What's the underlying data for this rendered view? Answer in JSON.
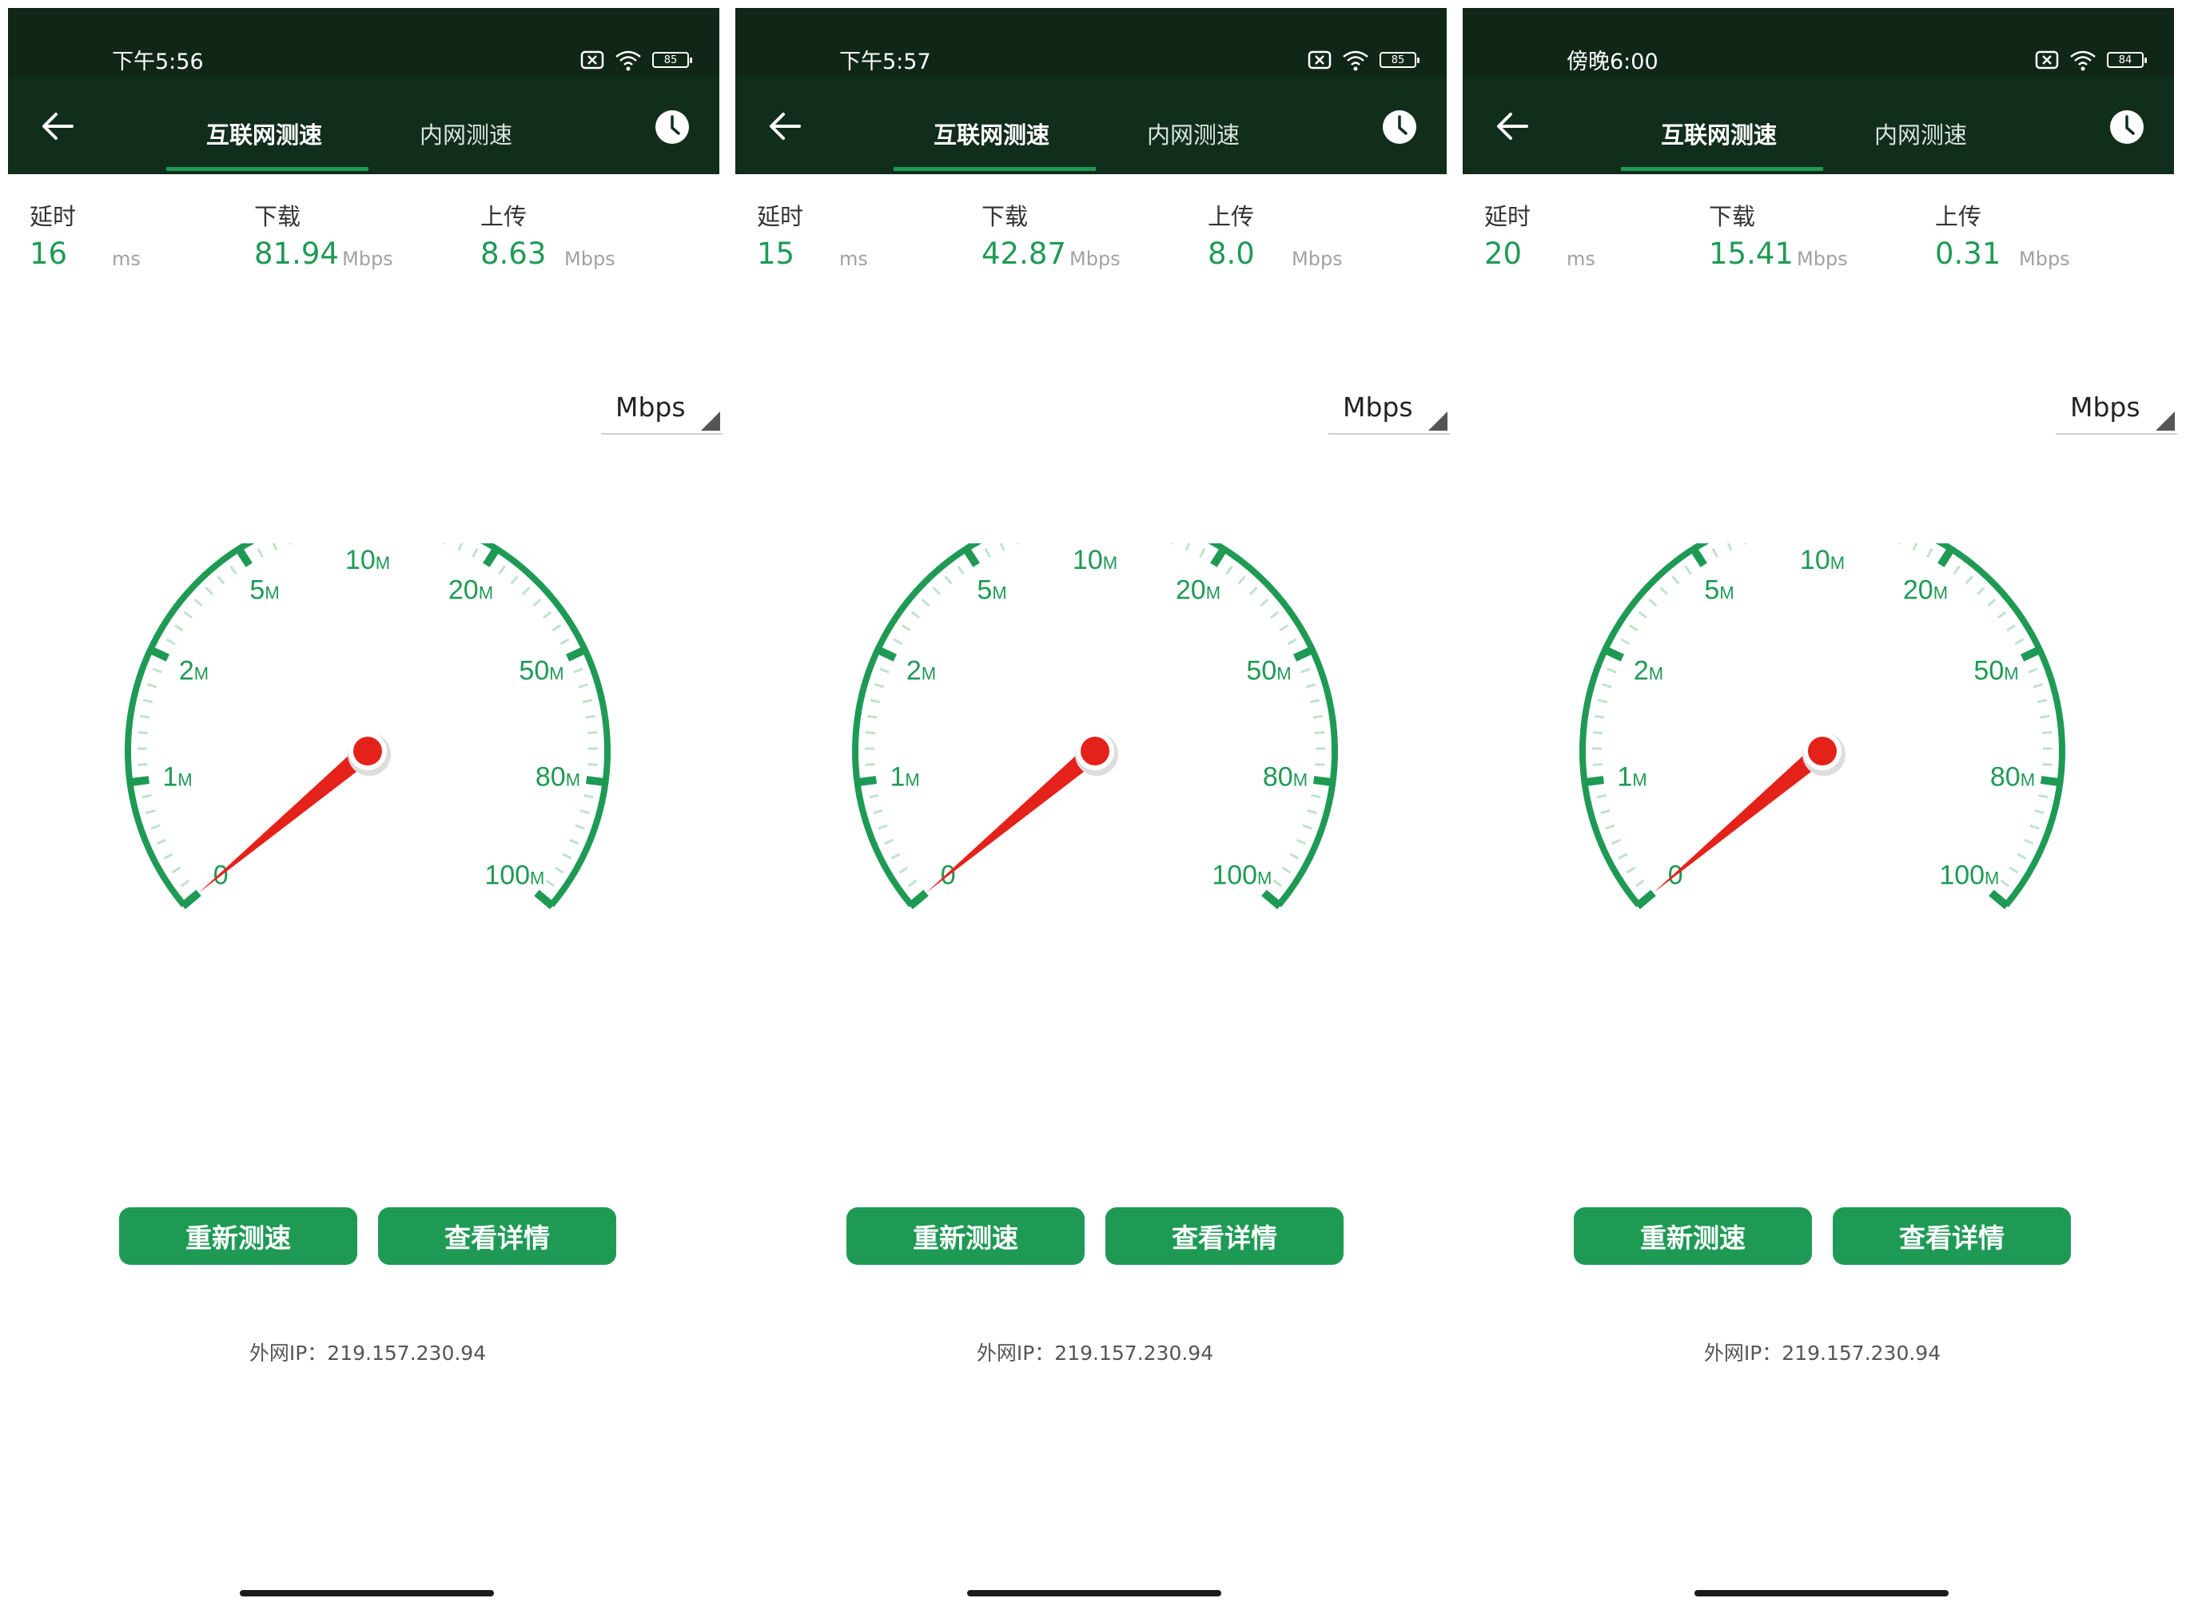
{
  "screens": [
    {
      "status": {
        "time": "下午5:56",
        "battery": "85"
      },
      "tabs": {
        "internet": "互联网测速",
        "intranet": "内网测速"
      },
      "metrics": {
        "latency": {
          "label": "延时",
          "value": "16",
          "unit": "ms"
        },
        "download": {
          "label": "下载",
          "value": "81.94",
          "unit": "Mbps"
        },
        "upload": {
          "label": "上传",
          "value": "8.63",
          "unit": "Mbps"
        }
      },
      "unit_select": "Mbps",
      "gauge": {
        "needle_value": 0
      },
      "buttons": {
        "retest": "重新测速",
        "details": "查看详情"
      },
      "ip": "外网IP：219.157.230.94"
    },
    {
      "status": {
        "time": "下午5:57",
        "battery": "85"
      },
      "tabs": {
        "internet": "互联网测速",
        "intranet": "内网测速"
      },
      "metrics": {
        "latency": {
          "label": "延时",
          "value": "15",
          "unit": "ms"
        },
        "download": {
          "label": "下载",
          "value": "42.87",
          "unit": "Mbps"
        },
        "upload": {
          "label": "上传",
          "value": "8.0",
          "unit": "Mbps"
        }
      },
      "unit_select": "Mbps",
      "gauge": {
        "needle_value": 0
      },
      "buttons": {
        "retest": "重新测速",
        "details": "查看详情"
      },
      "ip": "外网IP：219.157.230.94"
    },
    {
      "status": {
        "time": "傍晚6:00",
        "battery": "84"
      },
      "tabs": {
        "internet": "互联网测速",
        "intranet": "内网测速"
      },
      "metrics": {
        "latency": {
          "label": "延时",
          "value": "20",
          "unit": "ms"
        },
        "download": {
          "label": "下载",
          "value": "15.41",
          "unit": "Mbps"
        },
        "upload": {
          "label": "上传",
          "value": "0.31",
          "unit": "Mbps"
        }
      },
      "unit_select": "Mbps",
      "gauge": {
        "needle_value": 0
      },
      "buttons": {
        "retest": "重新测速",
        "details": "查看详情"
      },
      "ip": "外网IP：219.157.230.94"
    }
  ],
  "gauge_scale": {
    "numbers": [
      "0",
      "1",
      "2",
      "5",
      "10",
      "20",
      "50",
      "80",
      "100"
    ],
    "suffix": "M"
  },
  "colors": {
    "header": "#112d1b",
    "accent": "#1f9a55",
    "needle": "#e4221a"
  },
  "icons": {
    "back": "arrow-left-icon",
    "history": "clock-icon",
    "signal": "no-sim-icon",
    "wifi": "wifi-icon",
    "battery": "battery-icon"
  }
}
